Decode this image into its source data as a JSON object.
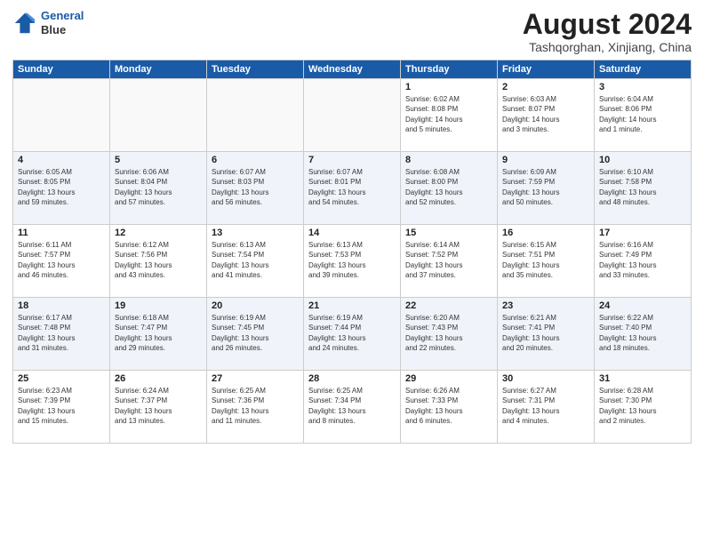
{
  "header": {
    "logo_line1": "General",
    "logo_line2": "Blue",
    "month": "August 2024",
    "location": "Tashqorghan, Xinjiang, China"
  },
  "weekdays": [
    "Sunday",
    "Monday",
    "Tuesday",
    "Wednesday",
    "Thursday",
    "Friday",
    "Saturday"
  ],
  "weeks": [
    [
      {
        "day": "",
        "info": ""
      },
      {
        "day": "",
        "info": ""
      },
      {
        "day": "",
        "info": ""
      },
      {
        "day": "",
        "info": ""
      },
      {
        "day": "1",
        "info": "Sunrise: 6:02 AM\nSunset: 8:08 PM\nDaylight: 14 hours\nand 5 minutes."
      },
      {
        "day": "2",
        "info": "Sunrise: 6:03 AM\nSunset: 8:07 PM\nDaylight: 14 hours\nand 3 minutes."
      },
      {
        "day": "3",
        "info": "Sunrise: 6:04 AM\nSunset: 8:06 PM\nDaylight: 14 hours\nand 1 minute."
      }
    ],
    [
      {
        "day": "4",
        "info": "Sunrise: 6:05 AM\nSunset: 8:05 PM\nDaylight: 13 hours\nand 59 minutes."
      },
      {
        "day": "5",
        "info": "Sunrise: 6:06 AM\nSunset: 8:04 PM\nDaylight: 13 hours\nand 57 minutes."
      },
      {
        "day": "6",
        "info": "Sunrise: 6:07 AM\nSunset: 8:03 PM\nDaylight: 13 hours\nand 56 minutes."
      },
      {
        "day": "7",
        "info": "Sunrise: 6:07 AM\nSunset: 8:01 PM\nDaylight: 13 hours\nand 54 minutes."
      },
      {
        "day": "8",
        "info": "Sunrise: 6:08 AM\nSunset: 8:00 PM\nDaylight: 13 hours\nand 52 minutes."
      },
      {
        "day": "9",
        "info": "Sunrise: 6:09 AM\nSunset: 7:59 PM\nDaylight: 13 hours\nand 50 minutes."
      },
      {
        "day": "10",
        "info": "Sunrise: 6:10 AM\nSunset: 7:58 PM\nDaylight: 13 hours\nand 48 minutes."
      }
    ],
    [
      {
        "day": "11",
        "info": "Sunrise: 6:11 AM\nSunset: 7:57 PM\nDaylight: 13 hours\nand 46 minutes."
      },
      {
        "day": "12",
        "info": "Sunrise: 6:12 AM\nSunset: 7:56 PM\nDaylight: 13 hours\nand 43 minutes."
      },
      {
        "day": "13",
        "info": "Sunrise: 6:13 AM\nSunset: 7:54 PM\nDaylight: 13 hours\nand 41 minutes."
      },
      {
        "day": "14",
        "info": "Sunrise: 6:13 AM\nSunset: 7:53 PM\nDaylight: 13 hours\nand 39 minutes."
      },
      {
        "day": "15",
        "info": "Sunrise: 6:14 AM\nSunset: 7:52 PM\nDaylight: 13 hours\nand 37 minutes."
      },
      {
        "day": "16",
        "info": "Sunrise: 6:15 AM\nSunset: 7:51 PM\nDaylight: 13 hours\nand 35 minutes."
      },
      {
        "day": "17",
        "info": "Sunrise: 6:16 AM\nSunset: 7:49 PM\nDaylight: 13 hours\nand 33 minutes."
      }
    ],
    [
      {
        "day": "18",
        "info": "Sunrise: 6:17 AM\nSunset: 7:48 PM\nDaylight: 13 hours\nand 31 minutes."
      },
      {
        "day": "19",
        "info": "Sunrise: 6:18 AM\nSunset: 7:47 PM\nDaylight: 13 hours\nand 29 minutes."
      },
      {
        "day": "20",
        "info": "Sunrise: 6:19 AM\nSunset: 7:45 PM\nDaylight: 13 hours\nand 26 minutes."
      },
      {
        "day": "21",
        "info": "Sunrise: 6:19 AM\nSunset: 7:44 PM\nDaylight: 13 hours\nand 24 minutes."
      },
      {
        "day": "22",
        "info": "Sunrise: 6:20 AM\nSunset: 7:43 PM\nDaylight: 13 hours\nand 22 minutes."
      },
      {
        "day": "23",
        "info": "Sunrise: 6:21 AM\nSunset: 7:41 PM\nDaylight: 13 hours\nand 20 minutes."
      },
      {
        "day": "24",
        "info": "Sunrise: 6:22 AM\nSunset: 7:40 PM\nDaylight: 13 hours\nand 18 minutes."
      }
    ],
    [
      {
        "day": "25",
        "info": "Sunrise: 6:23 AM\nSunset: 7:39 PM\nDaylight: 13 hours\nand 15 minutes."
      },
      {
        "day": "26",
        "info": "Sunrise: 6:24 AM\nSunset: 7:37 PM\nDaylight: 13 hours\nand 13 minutes."
      },
      {
        "day": "27",
        "info": "Sunrise: 6:25 AM\nSunset: 7:36 PM\nDaylight: 13 hours\nand 11 minutes."
      },
      {
        "day": "28",
        "info": "Sunrise: 6:25 AM\nSunset: 7:34 PM\nDaylight: 13 hours\nand 8 minutes."
      },
      {
        "day": "29",
        "info": "Sunrise: 6:26 AM\nSunset: 7:33 PM\nDaylight: 13 hours\nand 6 minutes."
      },
      {
        "day": "30",
        "info": "Sunrise: 6:27 AM\nSunset: 7:31 PM\nDaylight: 13 hours\nand 4 minutes."
      },
      {
        "day": "31",
        "info": "Sunrise: 6:28 AM\nSunset: 7:30 PM\nDaylight: 13 hours\nand 2 minutes."
      }
    ]
  ]
}
